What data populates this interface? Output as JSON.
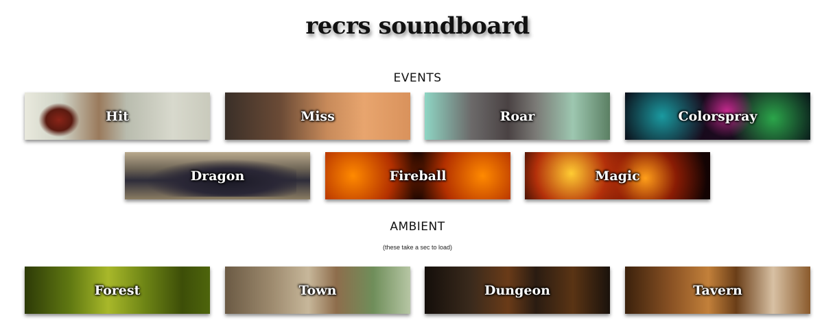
{
  "header": {
    "title": "recrs soundboard"
  },
  "sections": {
    "events": {
      "heading": "EVENTS",
      "buttons": [
        {
          "label": "Hit"
        },
        {
          "label": "Miss"
        },
        {
          "label": "Roar"
        },
        {
          "label": "Colorspray"
        },
        {
          "label": "Dragon"
        },
        {
          "label": "Fireball"
        },
        {
          "label": "Magic"
        }
      ]
    },
    "ambient": {
      "heading": "AMBIENT",
      "note": "(these take a sec to load)",
      "buttons": [
        {
          "label": "Forest"
        },
        {
          "label": "Town"
        },
        {
          "label": "Dungeon"
        },
        {
          "label": "Tavern"
        }
      ]
    }
  }
}
